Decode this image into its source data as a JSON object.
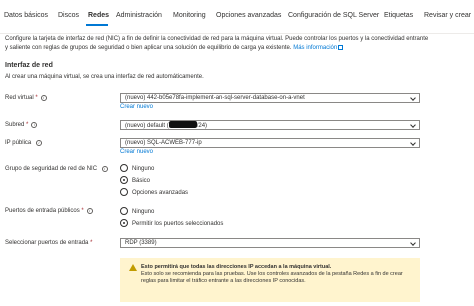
{
  "tabs": [
    {
      "label": "Datos básicos"
    },
    {
      "label": "Discos"
    },
    {
      "label": "Redes"
    },
    {
      "label": "Administración"
    },
    {
      "label": "Monitoring"
    },
    {
      "label": "Opciones avanzadas"
    },
    {
      "label": "Configuración de SQL Server"
    },
    {
      "label": "Etiquetas"
    },
    {
      "label": "Revisar y crear"
    }
  ],
  "description": {
    "text": "Configure la tarjeta de interfaz de red (NIC) a fin de definir la conectividad de red para la máquina virtual. Puede controlar los puertos y la conectividad entrante y saliente con reglas de grupos de seguridad o bien aplicar una solución de equilibrio de carga ya existente.",
    "link": "Más información"
  },
  "section": {
    "title": "Interfaz de red",
    "note": "Al crear una máquina virtual, se crea una interfaz de red automáticamente."
  },
  "fields": {
    "vnet": {
      "label": "Red virtual",
      "value": "(nuevo) 442-b05e78fa-implement-an-sql-server-database-on-a-vnet",
      "create": "Crear nuevo"
    },
    "subnet": {
      "label": "Subred",
      "value_prefix": "(nuevo) default (",
      "value_suffix": "/24)"
    },
    "public_ip": {
      "label": "IP pública",
      "value": "(nuevo) SQL-ACWEB-777-ip",
      "create": "Crear nuevo"
    },
    "nsg": {
      "label": "Grupo de seguridad de red de NIC",
      "options": [
        "Ninguno",
        "Básico",
        "Opciones avanzadas"
      ]
    },
    "inbound_ports": {
      "label": "Puertos de entrada públicos",
      "options": [
        "Ninguno",
        "Permitir los puertos seleccionados"
      ]
    },
    "select_ports": {
      "label": "Seleccionar puertos de entrada",
      "value": "RDP (3389)"
    }
  },
  "warning": {
    "bold": "Esto permitirá que todas las direcciones IP accedan a la máquina virtual.",
    "text": "Esto solo se recomienda para las pruebas. Use los controles avanzados de la pestaña Redes a fin de crear reglas para limitar el tráfico entrante a las direcciones IP conocidas."
  },
  "colors": {
    "accent": "#0078d4",
    "required": "#a4262c",
    "warning_bg": "#fff4ce",
    "warning_icon": "#c19c00"
  }
}
